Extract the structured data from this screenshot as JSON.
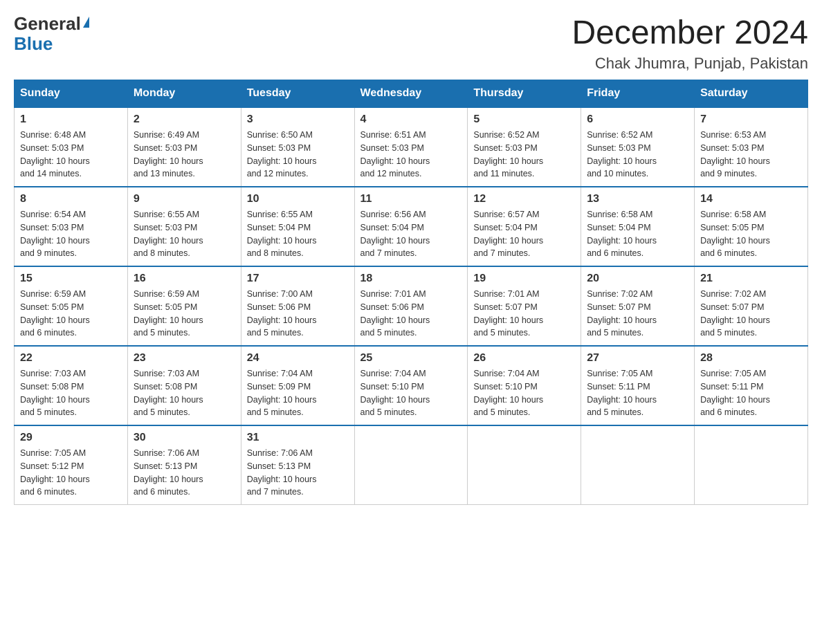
{
  "header": {
    "logo_general": "General",
    "logo_blue": "Blue",
    "month_title": "December 2024",
    "location": "Chak Jhumra, Punjab, Pakistan"
  },
  "weekdays": [
    "Sunday",
    "Monday",
    "Tuesday",
    "Wednesday",
    "Thursday",
    "Friday",
    "Saturday"
  ],
  "weeks": [
    [
      {
        "day": "1",
        "sunrise": "6:48 AM",
        "sunset": "5:03 PM",
        "daylight": "10 hours and 14 minutes."
      },
      {
        "day": "2",
        "sunrise": "6:49 AM",
        "sunset": "5:03 PM",
        "daylight": "10 hours and 13 minutes."
      },
      {
        "day": "3",
        "sunrise": "6:50 AM",
        "sunset": "5:03 PM",
        "daylight": "10 hours and 12 minutes."
      },
      {
        "day": "4",
        "sunrise": "6:51 AM",
        "sunset": "5:03 PM",
        "daylight": "10 hours and 12 minutes."
      },
      {
        "day": "5",
        "sunrise": "6:52 AM",
        "sunset": "5:03 PM",
        "daylight": "10 hours and 11 minutes."
      },
      {
        "day": "6",
        "sunrise": "6:52 AM",
        "sunset": "5:03 PM",
        "daylight": "10 hours and 10 minutes."
      },
      {
        "day": "7",
        "sunrise": "6:53 AM",
        "sunset": "5:03 PM",
        "daylight": "10 hours and 9 minutes."
      }
    ],
    [
      {
        "day": "8",
        "sunrise": "6:54 AM",
        "sunset": "5:03 PM",
        "daylight": "10 hours and 9 minutes."
      },
      {
        "day": "9",
        "sunrise": "6:55 AM",
        "sunset": "5:03 PM",
        "daylight": "10 hours and 8 minutes."
      },
      {
        "day": "10",
        "sunrise": "6:55 AM",
        "sunset": "5:04 PM",
        "daylight": "10 hours and 8 minutes."
      },
      {
        "day": "11",
        "sunrise": "6:56 AM",
        "sunset": "5:04 PM",
        "daylight": "10 hours and 7 minutes."
      },
      {
        "day": "12",
        "sunrise": "6:57 AM",
        "sunset": "5:04 PM",
        "daylight": "10 hours and 7 minutes."
      },
      {
        "day": "13",
        "sunrise": "6:58 AM",
        "sunset": "5:04 PM",
        "daylight": "10 hours and 6 minutes."
      },
      {
        "day": "14",
        "sunrise": "6:58 AM",
        "sunset": "5:05 PM",
        "daylight": "10 hours and 6 minutes."
      }
    ],
    [
      {
        "day": "15",
        "sunrise": "6:59 AM",
        "sunset": "5:05 PM",
        "daylight": "10 hours and 6 minutes."
      },
      {
        "day": "16",
        "sunrise": "6:59 AM",
        "sunset": "5:05 PM",
        "daylight": "10 hours and 5 minutes."
      },
      {
        "day": "17",
        "sunrise": "7:00 AM",
        "sunset": "5:06 PM",
        "daylight": "10 hours and 5 minutes."
      },
      {
        "day": "18",
        "sunrise": "7:01 AM",
        "sunset": "5:06 PM",
        "daylight": "10 hours and 5 minutes."
      },
      {
        "day": "19",
        "sunrise": "7:01 AM",
        "sunset": "5:07 PM",
        "daylight": "10 hours and 5 minutes."
      },
      {
        "day": "20",
        "sunrise": "7:02 AM",
        "sunset": "5:07 PM",
        "daylight": "10 hours and 5 minutes."
      },
      {
        "day": "21",
        "sunrise": "7:02 AM",
        "sunset": "5:07 PM",
        "daylight": "10 hours and 5 minutes."
      }
    ],
    [
      {
        "day": "22",
        "sunrise": "7:03 AM",
        "sunset": "5:08 PM",
        "daylight": "10 hours and 5 minutes."
      },
      {
        "day": "23",
        "sunrise": "7:03 AM",
        "sunset": "5:08 PM",
        "daylight": "10 hours and 5 minutes."
      },
      {
        "day": "24",
        "sunrise": "7:04 AM",
        "sunset": "5:09 PM",
        "daylight": "10 hours and 5 minutes."
      },
      {
        "day": "25",
        "sunrise": "7:04 AM",
        "sunset": "5:10 PM",
        "daylight": "10 hours and 5 minutes."
      },
      {
        "day": "26",
        "sunrise": "7:04 AM",
        "sunset": "5:10 PM",
        "daylight": "10 hours and 5 minutes."
      },
      {
        "day": "27",
        "sunrise": "7:05 AM",
        "sunset": "5:11 PM",
        "daylight": "10 hours and 5 minutes."
      },
      {
        "day": "28",
        "sunrise": "7:05 AM",
        "sunset": "5:11 PM",
        "daylight": "10 hours and 6 minutes."
      }
    ],
    [
      {
        "day": "29",
        "sunrise": "7:05 AM",
        "sunset": "5:12 PM",
        "daylight": "10 hours and 6 minutes."
      },
      {
        "day": "30",
        "sunrise": "7:06 AM",
        "sunset": "5:13 PM",
        "daylight": "10 hours and 6 minutes."
      },
      {
        "day": "31",
        "sunrise": "7:06 AM",
        "sunset": "5:13 PM",
        "daylight": "10 hours and 7 minutes."
      },
      null,
      null,
      null,
      null
    ]
  ],
  "labels": {
    "sunrise": "Sunrise: ",
    "sunset": "Sunset: ",
    "daylight": "Daylight: "
  }
}
